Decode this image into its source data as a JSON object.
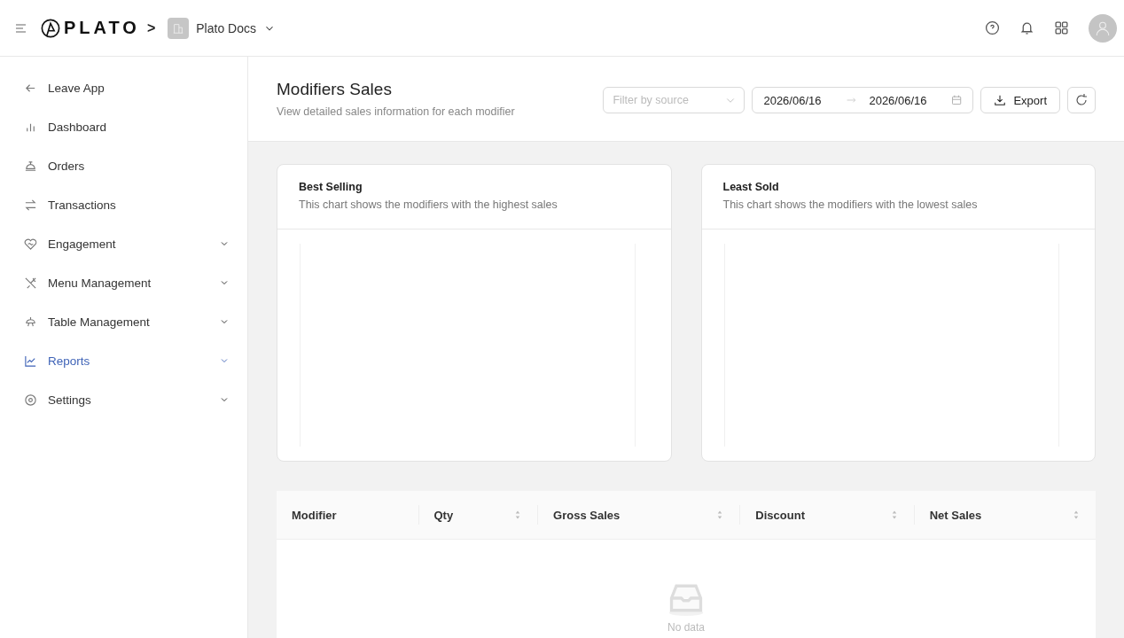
{
  "header": {
    "logo": "PLATO",
    "breadcrumb_separator": ">",
    "workspace": "Plato Docs"
  },
  "sidebar": {
    "items": [
      {
        "label": "Leave App",
        "kind": "link",
        "selected": false
      },
      {
        "label": "Dashboard",
        "kind": "link",
        "selected": false
      },
      {
        "label": "Orders",
        "kind": "link",
        "selected": false
      },
      {
        "label": "Transactions",
        "kind": "link",
        "selected": false
      },
      {
        "label": "Engagement",
        "kind": "group",
        "selected": false
      },
      {
        "label": "Menu Management",
        "kind": "group",
        "selected": false
      },
      {
        "label": "Table Management",
        "kind": "group",
        "selected": false
      },
      {
        "label": "Reports",
        "kind": "group",
        "selected": true
      },
      {
        "label": "Settings",
        "kind": "group",
        "selected": false
      }
    ]
  },
  "page": {
    "title": "Modifiers Sales",
    "subtitle": "View detailed sales information for each modifier",
    "filter": {
      "placeholder": "Filter by source"
    },
    "date_start": "2026/06/16",
    "date_end": "2026/06/16",
    "export": "Export"
  },
  "cards": [
    {
      "title": "Best Selling",
      "subtitle": "This chart shows the modifiers with the highest sales"
    },
    {
      "title": "Least Sold",
      "subtitle": "This chart shows the modifiers with the lowest sales"
    }
  ],
  "table": {
    "columns": [
      {
        "label": "Modifier",
        "sortable": false
      },
      {
        "label": "Qty",
        "sortable": true
      },
      {
        "label": "Gross Sales",
        "sortable": true
      },
      {
        "label": "Discount",
        "sortable": true
      },
      {
        "label": "Net Sales",
        "sortable": true
      }
    ],
    "empty_text": "No data"
  }
}
